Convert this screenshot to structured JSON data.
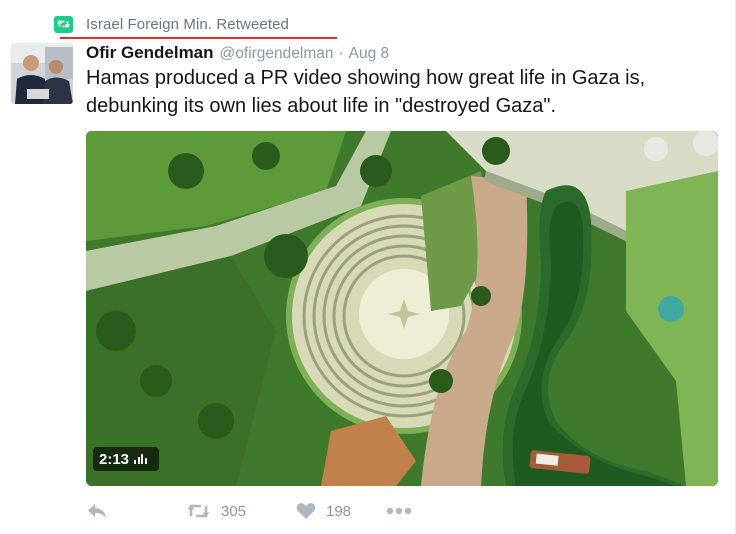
{
  "retweet_context": {
    "text": "Israel Foreign Min. Retweeted"
  },
  "tweet": {
    "author_name": "Ofir Gendelman",
    "handle": "@ofirgendelman",
    "separator": "·",
    "date": "Aug 8",
    "text_line1": "Hamas produced a PR video showing how great life in Gaza is,",
    "text_line2": "debunking its own lies about life in \"destroyed Gaza\"."
  },
  "media": {
    "duration": "2:13"
  },
  "actions": {
    "retweet_count": "305",
    "like_count": "198"
  },
  "colors": {
    "retweet_green": "#19cf86",
    "underline_red": "#e0302b",
    "muted_text": "#8899a6",
    "icon_gray": "#aab8c2"
  }
}
